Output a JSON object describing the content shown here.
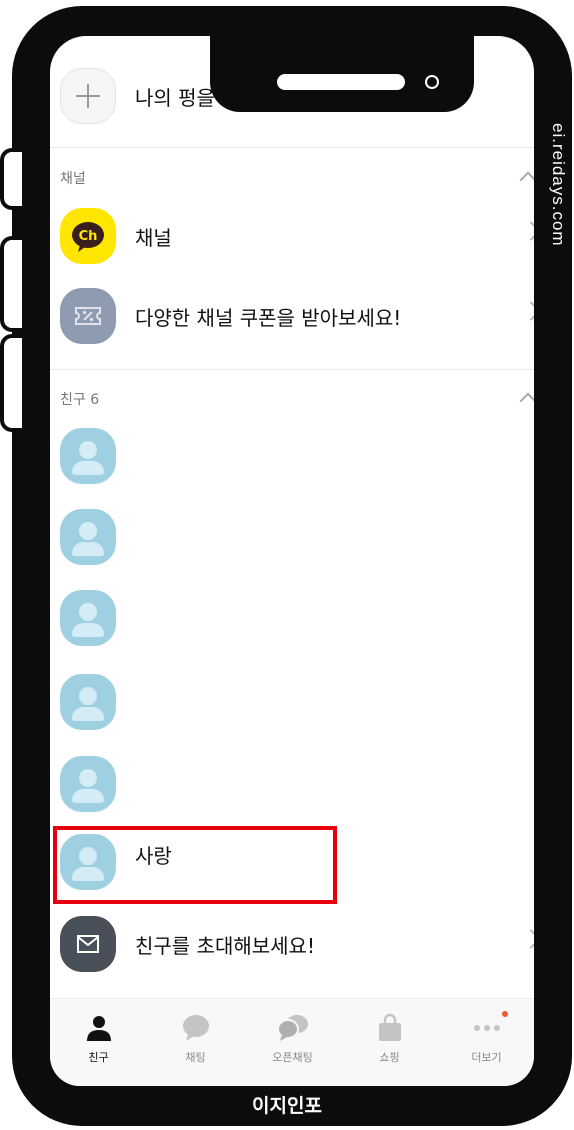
{
  "watermark": "ei.reidays.com",
  "footer_brand": "이지인포",
  "profile": {
    "create_label": "나의 펑을 만들어보세요!"
  },
  "sections": {
    "channel": {
      "title": "채널",
      "items": [
        {
          "label": "채널",
          "icon": "kakao-channel-icon",
          "color": "#ffe600"
        },
        {
          "label": "다양한 채널 쿠폰을 받아보세요!",
          "icon": "coupon-icon",
          "color": "#8f9bb0"
        }
      ]
    },
    "friends": {
      "title": "친구 6",
      "items": [
        {
          "label": ""
        },
        {
          "label": ""
        },
        {
          "label": ""
        },
        {
          "label": ""
        },
        {
          "label": ""
        },
        {
          "label": "사랑"
        }
      ],
      "invite": {
        "label": "친구를 초대해보세요!",
        "icon": "mail-icon",
        "color": "#4a505a"
      }
    }
  },
  "tabs": [
    {
      "label": "친구",
      "icon": "person-icon",
      "active": true
    },
    {
      "label": "채팅",
      "icon": "chat-bubble-icon",
      "active": false
    },
    {
      "label": "오픈채팅",
      "icon": "open-chat-icon",
      "active": false
    },
    {
      "label": "쇼핑",
      "icon": "shopping-bag-icon",
      "active": false
    },
    {
      "label": "더보기",
      "icon": "more-dots-icon",
      "active": false,
      "badge": true
    }
  ],
  "colors": {
    "highlight": "#e4000f",
    "friend_avatar": "#9ed0e2",
    "badge": "#f05a28"
  }
}
